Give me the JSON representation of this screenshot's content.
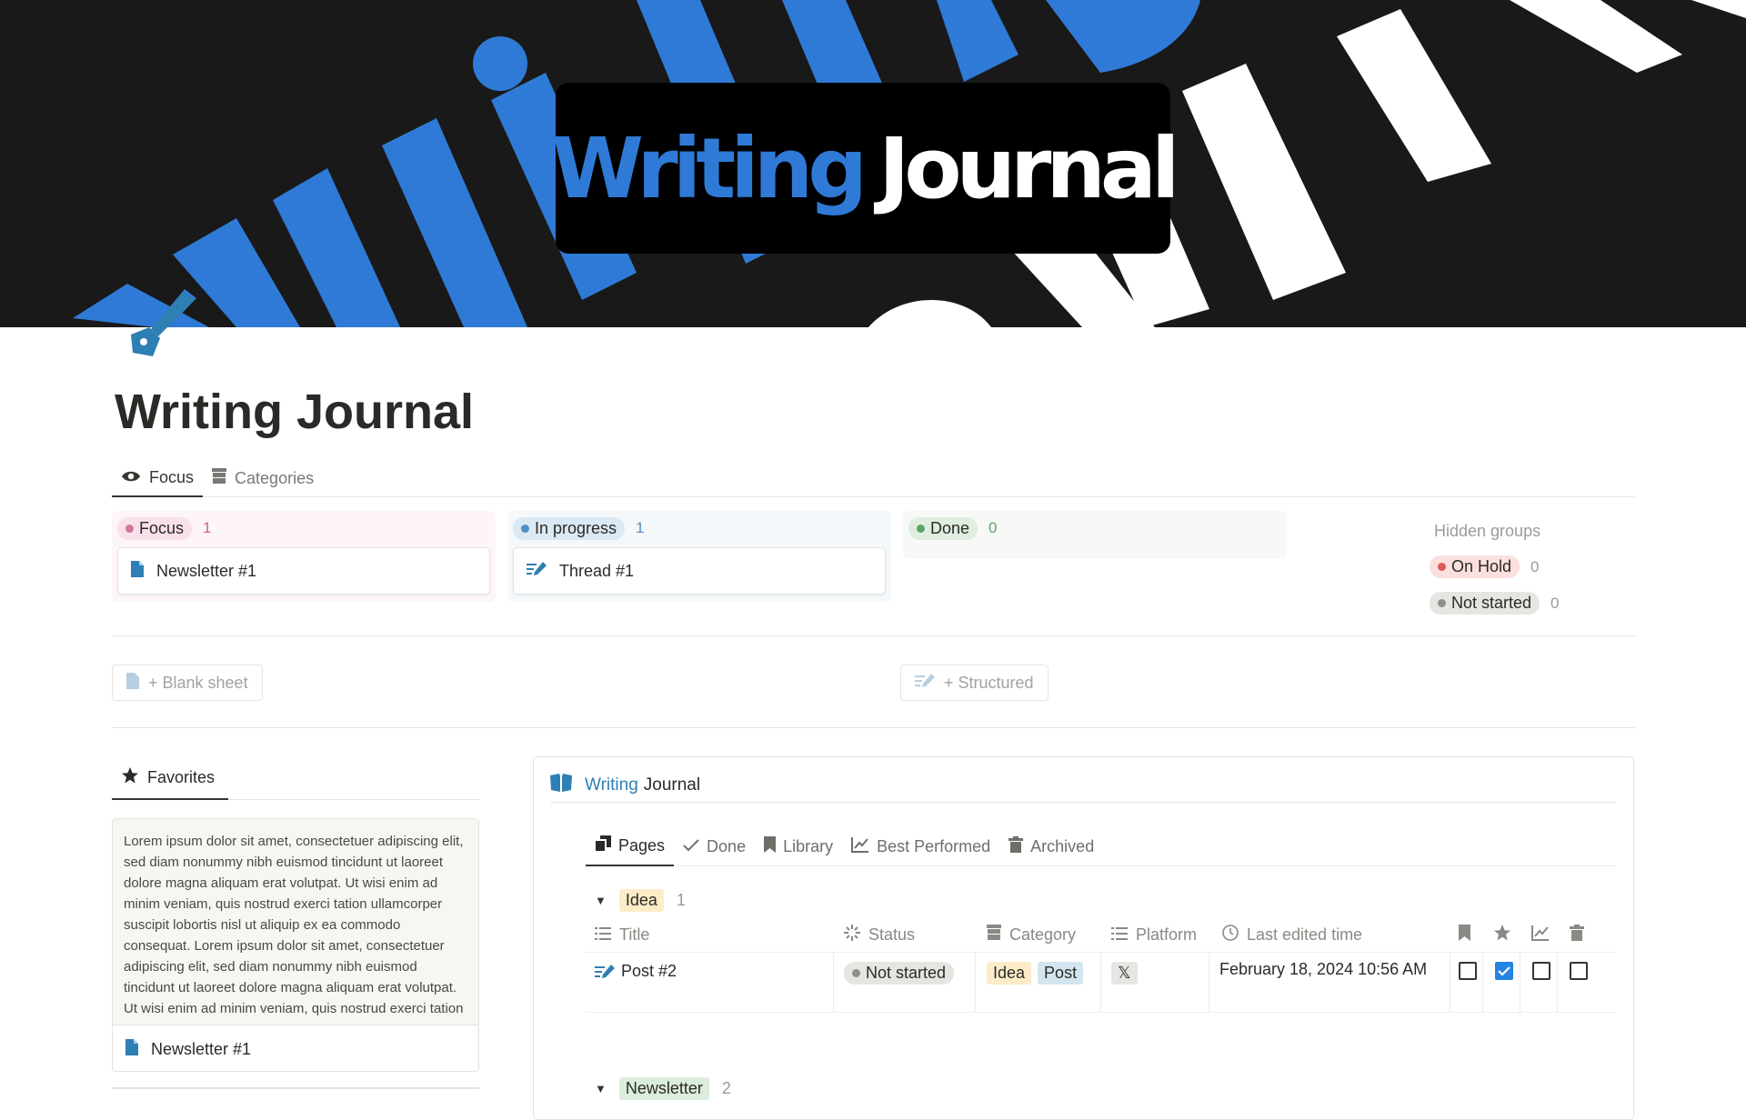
{
  "cover": {
    "word1": "Writing",
    "word2": "Journal"
  },
  "page": {
    "title": "Writing Journal"
  },
  "tabs": [
    {
      "label": "Focus"
    },
    {
      "label": "Categories"
    }
  ],
  "board": {
    "columns": [
      {
        "label": "Focus",
        "count": "1",
        "card": "Newsletter #1"
      },
      {
        "label": "In progress",
        "count": "1",
        "card": "Thread #1"
      },
      {
        "label": "Done",
        "count": "0"
      }
    ],
    "hidden_label": "Hidden groups",
    "hidden": [
      {
        "label": "On Hold",
        "count": "0"
      },
      {
        "label": "Not started",
        "count": "0"
      }
    ]
  },
  "templates": {
    "blank": "+ Blank sheet",
    "structured": "+ Structured"
  },
  "favorites": {
    "tab": "Favorites",
    "text": "Lorem ipsum dolor sit amet, consectetuer adipiscing elit, sed diam nonummy nibh euismod tincidunt ut laoreet dolore magna aliquam erat volutpat. Ut wisi enim ad minim veniam, quis nostrud exerci tation ullamcorper suscipit lobortis nisl ut aliquip ex ea commodo consequat. Lorem ipsum dolor sit amet, consectetuer adipiscing elit, sed diam nonummy nibh euismod tincidunt ut laoreet dolore magna aliquam erat volutpat. Ut wisi enim ad minim veniam, quis nostrud exerci tation",
    "item": "Newsletter #1"
  },
  "database": {
    "title_part1": "Writing",
    "title_part2": "Journal",
    "views": [
      {
        "label": "Pages"
      },
      {
        "label": "Done"
      },
      {
        "label": "Library"
      },
      {
        "label": "Best Performed"
      },
      {
        "label": "Archived"
      }
    ],
    "group1": {
      "label": "Idea",
      "count": "1"
    },
    "columns": {
      "title": "Title",
      "status": "Status",
      "category": "Category",
      "platform": "Platform",
      "edited": "Last edited time"
    },
    "row": {
      "title": "Post #2",
      "status": "Not started",
      "category": [
        "Idea",
        "Post"
      ],
      "platform": "𝕏",
      "edited": "February 18, 2024 10:56 AM",
      "bookmark": false,
      "star": true,
      "best": false,
      "archived": false
    },
    "group2": {
      "label": "Newsletter",
      "count": "2"
    }
  },
  "colors": {
    "accent": "#2f7ad6",
    "focus_bg": "#fdf5f8",
    "progress_bg": "#f4f8fb",
    "done_bg": "#f6f9f5"
  }
}
